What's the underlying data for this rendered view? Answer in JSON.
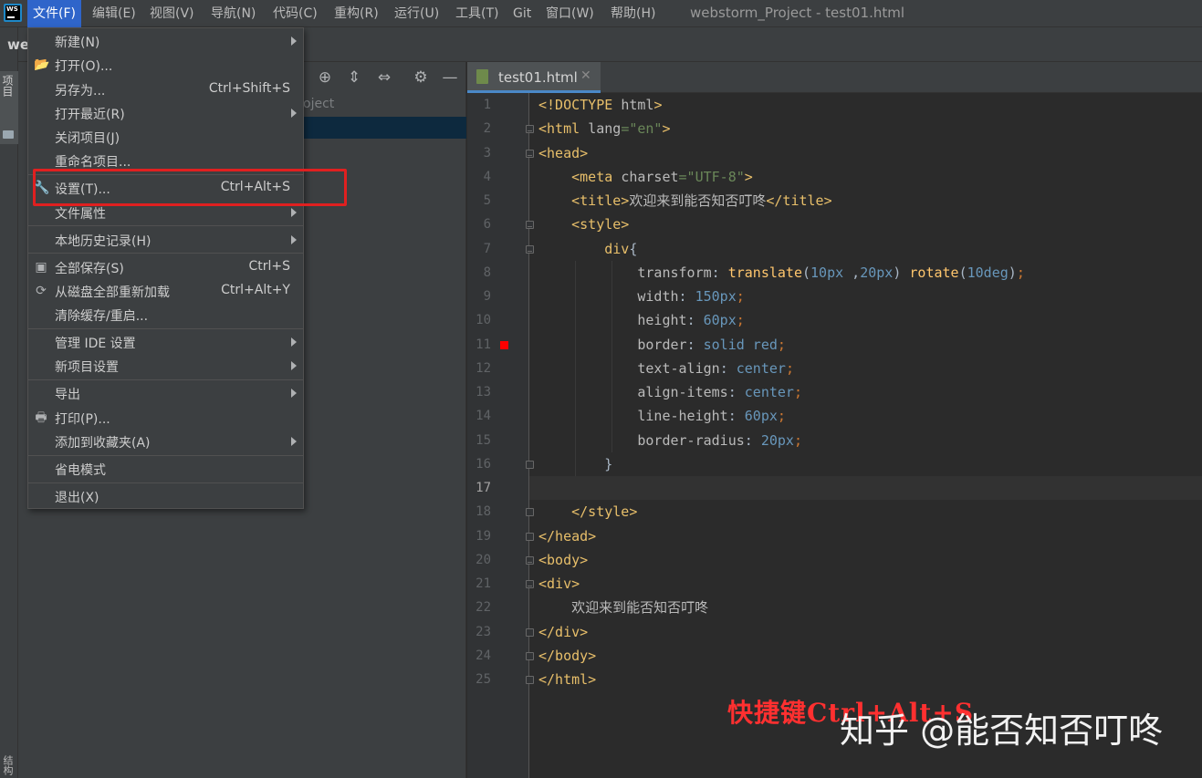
{
  "menubar": {
    "items": [
      {
        "label": "文件(F)",
        "active": true
      },
      {
        "label": "编辑(E)",
        "active": false
      },
      {
        "label": "视图(V)",
        "active": false
      },
      {
        "label": "导航(N)",
        "active": false
      },
      {
        "label": "代码(C)",
        "active": false
      },
      {
        "label": "重构(R)",
        "active": false
      },
      {
        "label": "运行(U)",
        "active": false
      },
      {
        "label": "工具(T)",
        "active": false
      },
      {
        "label": "Git",
        "active": false
      },
      {
        "label": "窗口(W)",
        "active": false
      },
      {
        "label": "帮助(H)",
        "active": false
      }
    ],
    "window_title": "webstorm_Project - test01.html"
  },
  "left_strip": {
    "project_tab_label": "项目",
    "bottom_tab_label": "结构"
  },
  "project_panel": {
    "title_fragment": "we",
    "subtitle_fragment": "oject",
    "toolbar_icons": [
      "crosshair-icon",
      "expand-all-icon",
      "collapse-all-icon",
      "gear-icon",
      "minimize-icon"
    ]
  },
  "file_menu": {
    "items": [
      {
        "label": "新建(N)",
        "shortcut": "",
        "submenu": true,
        "icon": ""
      },
      {
        "label": "打开(O)...",
        "shortcut": "",
        "submenu": false,
        "icon": "folder-open-icon"
      },
      {
        "label": "另存为...",
        "shortcut": "Ctrl+Shift+S",
        "submenu": false,
        "icon": ""
      },
      {
        "label": "打开最近(R)",
        "shortcut": "",
        "submenu": true,
        "icon": ""
      },
      {
        "label": "关闭项目(J)",
        "shortcut": "",
        "submenu": false,
        "icon": ""
      },
      {
        "label": "重命名项目...",
        "shortcut": "",
        "submenu": false,
        "icon": ""
      },
      {
        "label": "设置(T)...",
        "shortcut": "Ctrl+Alt+S",
        "submenu": false,
        "icon": "wrench-icon",
        "highlighted": true
      },
      {
        "label": "文件属性",
        "shortcut": "",
        "submenu": true,
        "icon": ""
      },
      {
        "label": "本地历史记录(H)",
        "shortcut": "",
        "submenu": true,
        "icon": ""
      },
      {
        "label": "全部保存(S)",
        "shortcut": "Ctrl+S",
        "submenu": false,
        "icon": "save-icon"
      },
      {
        "label": "从磁盘全部重新加载",
        "shortcut": "Ctrl+Alt+Y",
        "submenu": false,
        "icon": "reload-icon"
      },
      {
        "label": "清除缓存/重启...",
        "shortcut": "",
        "submenu": false,
        "icon": ""
      },
      {
        "label": "管理 IDE 设置",
        "shortcut": "",
        "submenu": true,
        "icon": ""
      },
      {
        "label": "新项目设置",
        "shortcut": "",
        "submenu": true,
        "icon": ""
      },
      {
        "label": "导出",
        "shortcut": "",
        "submenu": true,
        "icon": ""
      },
      {
        "label": "打印(P)...",
        "shortcut": "",
        "submenu": false,
        "icon": "print-icon"
      },
      {
        "label": "添加到收藏夹(A)",
        "shortcut": "",
        "submenu": true,
        "icon": ""
      },
      {
        "label": "省电模式",
        "shortcut": "",
        "submenu": false,
        "icon": ""
      },
      {
        "label": "退出(X)",
        "shortcut": "",
        "submenu": false,
        "icon": ""
      }
    ]
  },
  "editor": {
    "tab_label": "test01.html",
    "tab_icon": "html-file-icon",
    "current_line": 17,
    "breakpoint_line": 11,
    "lines": [
      "<!DOCTYPE html>",
      "<html lang=\"en\">",
      "<head>",
      "    <meta charset=\"UTF-8\">",
      "    <title>欢迎来到能否知否叮咚</title>",
      "    <style>",
      "        div{",
      "            transform: translate(10px ,20px) rotate(10deg);",
      "            width: 150px;",
      "            height: 60px;",
      "            border: solid red;",
      "            text-align: center;",
      "            align-items: center;",
      "            line-height: 60px;",
      "            border-radius: 20px;",
      "        }",
      "",
      "    </style>",
      "</head>",
      "<body>",
      "<div>",
      "    欢迎来到能否知否叮咚",
      "</div>",
      "</body>",
      "</html>"
    ]
  },
  "watermark": {
    "annotation": "快捷键Ctrl+Alt+S",
    "credit": "知乎 @能否知否叮咚"
  },
  "colors": {
    "menu_active": "#2f65ca",
    "highlight_box": "#e02020",
    "breakpoint": "#ff0000",
    "tab_underline": "#4a88c7"
  }
}
